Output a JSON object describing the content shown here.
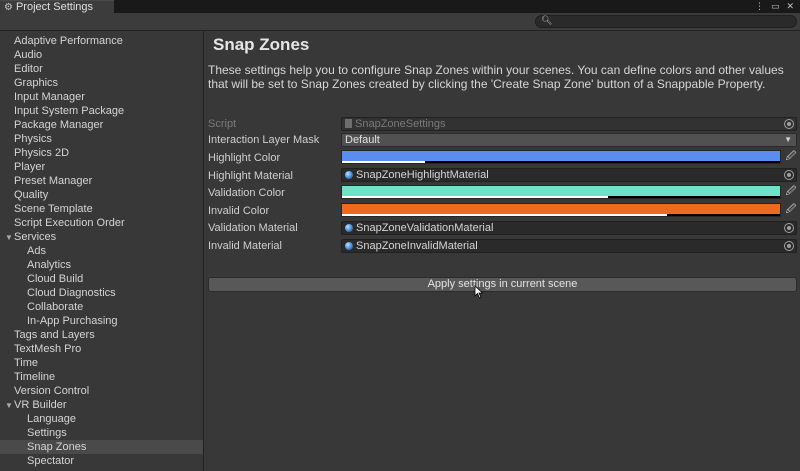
{
  "window": {
    "tab_title": "Project Settings",
    "tab_icon": "gear-icon",
    "controls": [
      "menu-icon",
      "maximize-icon",
      "close-icon"
    ]
  },
  "search": {
    "placeholder": ""
  },
  "sidebar": {
    "items": [
      {
        "label": "Adaptive Performance",
        "indent": 0
      },
      {
        "label": "Audio",
        "indent": 0
      },
      {
        "label": "Editor",
        "indent": 0
      },
      {
        "label": "Graphics",
        "indent": 0
      },
      {
        "label": "Input Manager",
        "indent": 0
      },
      {
        "label": "Input System Package",
        "indent": 0
      },
      {
        "label": "Package Manager",
        "indent": 0
      },
      {
        "label": "Physics",
        "indent": 0
      },
      {
        "label": "Physics 2D",
        "indent": 0
      },
      {
        "label": "Player",
        "indent": 0
      },
      {
        "label": "Preset Manager",
        "indent": 0
      },
      {
        "label": "Quality",
        "indent": 0
      },
      {
        "label": "Scene Template",
        "indent": 0
      },
      {
        "label": "Script Execution Order",
        "indent": 0
      },
      {
        "label": "Services",
        "indent": 0,
        "expanded": true
      },
      {
        "label": "Ads",
        "indent": 1
      },
      {
        "label": "Analytics",
        "indent": 1
      },
      {
        "label": "Cloud Build",
        "indent": 1
      },
      {
        "label": "Cloud Diagnostics",
        "indent": 1
      },
      {
        "label": "Collaborate",
        "indent": 1
      },
      {
        "label": "In-App Purchasing",
        "indent": 1
      },
      {
        "label": "Tags and Layers",
        "indent": 0
      },
      {
        "label": "TextMesh Pro",
        "indent": 0
      },
      {
        "label": "Time",
        "indent": 0
      },
      {
        "label": "Timeline",
        "indent": 0
      },
      {
        "label": "Version Control",
        "indent": 0
      },
      {
        "label": "VR Builder",
        "indent": 0,
        "expanded": true
      },
      {
        "label": "Language",
        "indent": 1
      },
      {
        "label": "Settings",
        "indent": 1
      },
      {
        "label": "Snap Zones",
        "indent": 1,
        "selected": true
      },
      {
        "label": "Spectator",
        "indent": 1
      }
    ]
  },
  "main": {
    "title": "Snap Zones",
    "description": "These settings help you to configure Snap Zones within your scenes. You can define colors and other values that will be set to Snap Zones created by clicking the 'Create Snap Zone' button of a Snappable Property.",
    "fields": {
      "script": {
        "label": "Script",
        "value": "SnapZoneSettings"
      },
      "interaction_layer_mask": {
        "label": "Interaction Layer Mask",
        "value": "Default"
      },
      "highlight_color": {
        "label": "Highlight Color",
        "color": "#5b8cf0",
        "alpha": 0.19
      },
      "highlight_material": {
        "label": "Highlight Material",
        "value": "SnapZoneHighlightMaterial"
      },
      "validation_color": {
        "label": "Validation Color",
        "color": "#6fe3c7",
        "alpha": 0.608
      },
      "invalid_color": {
        "label": "Invalid Color",
        "color": "#f06a1e",
        "alpha": 0.742
      },
      "validation_material": {
        "label": "Validation Material",
        "value": "SnapZoneValidationMaterial"
      },
      "invalid_material": {
        "label": "Invalid Material",
        "value": "SnapZoneInvalidMaterial"
      }
    },
    "apply_button": "Apply settings in current scene"
  }
}
